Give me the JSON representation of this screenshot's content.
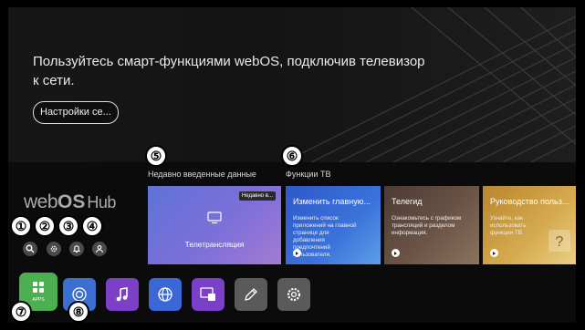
{
  "hero": {
    "message": "Пользуйтесь смарт-функциями webOS, подключив телевизор к сети.",
    "button_label": "Настройки се..."
  },
  "branding": {
    "logo_prefix": "web",
    "logo_os": "OS",
    "logo_suffix": "Hub"
  },
  "sections": {
    "recent_label": "Недавно введенные данные",
    "tv_functions_label": "Функции ТВ"
  },
  "recent_card": {
    "badge": "Недавно в...",
    "title": "Телетрансляция",
    "icon": "tv-icon"
  },
  "function_cards": [
    {
      "title": "Изменить главную...",
      "description": "Изменить список приложений на главной странице для добавления предпочтений пользователя.",
      "color": "#3a6fd0"
    },
    {
      "title": "Телегид",
      "description": "Ознакомьтесь с графиком трансляций и разделом информация.",
      "color": "#6b5446"
    },
    {
      "title": "Руководство польз...",
      "description": "Узнайте, как использовать функции ТВ.",
      "color": "#c9a24a"
    }
  ],
  "quick_buttons": [
    {
      "icon": "search-icon"
    },
    {
      "icon": "gear-icon"
    },
    {
      "icon": "bell-icon"
    },
    {
      "icon": "user-icon"
    }
  ],
  "apps": [
    {
      "icon": "apps-grid-icon",
      "label": "APPS",
      "color": "#4caf50"
    },
    {
      "icon": "camera-icon",
      "color": "#3b6fd0"
    },
    {
      "icon": "music-icon",
      "color": "#7b3fc8"
    },
    {
      "icon": "globe-icon",
      "color": "#3b66d6"
    },
    {
      "icon": "screen-share-icon",
      "color": "#7b3fc8"
    },
    {
      "icon": "pencil-icon",
      "color": "#5a5a5a"
    },
    {
      "icon": "settings-icon",
      "color": "#5a5a5a"
    }
  ],
  "markers": [
    "①",
    "②",
    "③",
    "④",
    "⑤",
    "⑥",
    "⑦",
    "⑧"
  ]
}
